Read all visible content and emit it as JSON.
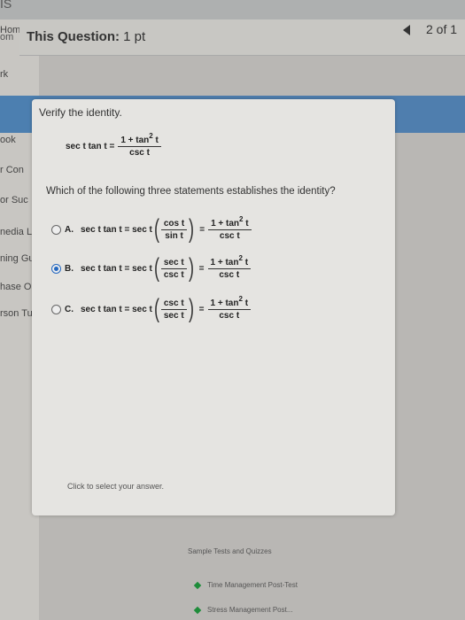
{
  "top_fragment": "IS",
  "sidebar": {
    "items": [
      "Hom",
      "rk",
      "ook",
      "r Con",
      "or Suc",
      "nedia L",
      "ning Gui",
      "hase Op",
      "rson Tut"
    ]
  },
  "header": {
    "title_bold": "This Question:",
    "title_rest": " 1 pt",
    "left_partial": "om"
  },
  "pager": {
    "count": "2 of 1"
  },
  "question": {
    "instruction": "Verify the identity.",
    "identity_lhs": "sec t tan t =",
    "identity_num": "1 + tan",
    "identity_exp": "2",
    "identity_t": " t",
    "identity_den": "csc t",
    "prompt": "Which of the following three statements establishes the identity?"
  },
  "options": [
    {
      "letter": "A.",
      "lhs": "sec t tan t = sec t",
      "pnum": "cos t",
      "pden": "sin t",
      "rnum": "1 + tan",
      "rexp": "2",
      "rt": " t",
      "rden": "csc t",
      "selected": false
    },
    {
      "letter": "B.",
      "lhs": "sec t tan t = sec t",
      "pnum": "sec t",
      "pden": "csc t",
      "rnum": "1 + tan",
      "rexp": "2",
      "rt": " t",
      "rden": "csc t",
      "selected": true
    },
    {
      "letter": "C.",
      "lhs": "sec t tan t = sec t",
      "pnum": "csc t",
      "pden": "sec t",
      "rnum": "1 + tan",
      "rexp": "2",
      "rt": " t",
      "rden": "csc t",
      "selected": false
    }
  ],
  "footer": {
    "click_hint": "Click to select your answer."
  },
  "links": [
    "Sample Tests and Quizzes",
    "Time Management Post-Test",
    "Stress Management Post..."
  ],
  "colors": {
    "accent_blue": "#2468c0",
    "band_blue": "#4f7eae",
    "link_green": "#1e8c3a"
  }
}
